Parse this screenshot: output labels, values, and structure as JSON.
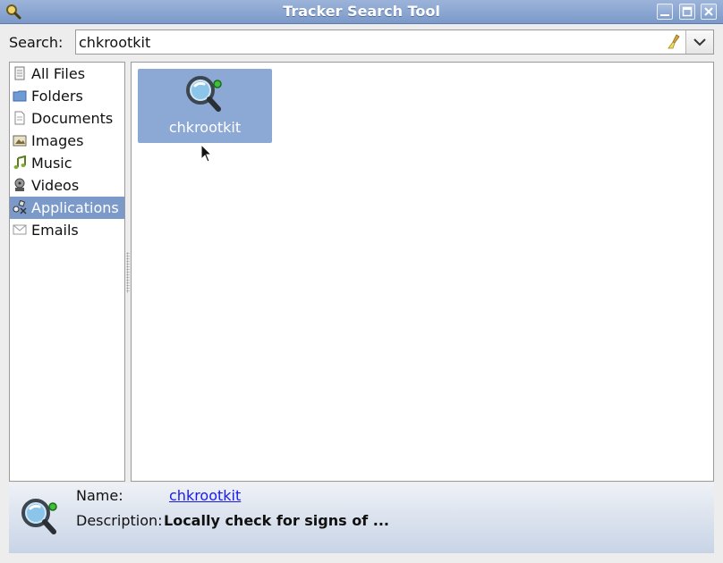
{
  "window": {
    "title": "Tracker Search Tool",
    "icon": "search-magnifier-icon",
    "controls": [
      "minimize-icon",
      "maximize-icon",
      "close-icon"
    ]
  },
  "search": {
    "label": "Search:",
    "value": "chkrootkit"
  },
  "categories": [
    {
      "label": "All Files",
      "icon": "all-files-icon"
    },
    {
      "label": "Folders",
      "icon": "folder-icon"
    },
    {
      "label": "Documents",
      "icon": "document-icon"
    },
    {
      "label": "Images",
      "icon": "image-icon"
    },
    {
      "label": "Music",
      "icon": "music-icon"
    },
    {
      "label": "Videos",
      "icon": "video-icon"
    },
    {
      "label": "Applications",
      "icon": "applications-icon",
      "selected": true
    },
    {
      "label": "Emails",
      "icon": "email-icon"
    }
  ],
  "results": [
    {
      "label": "chkrootkit",
      "icon": "chkrootkit-app-icon",
      "selected": true
    }
  ],
  "details": {
    "name_label": "Name:",
    "name_value": "chkrootkit",
    "description_label": "Description:",
    "description_value": "Locally check for signs of ..."
  },
  "colors": {
    "titlebar": "#7b99c9",
    "selection": "#7b99c9",
    "result_selection": "#8ca8d4",
    "link": "#1a1aee"
  }
}
